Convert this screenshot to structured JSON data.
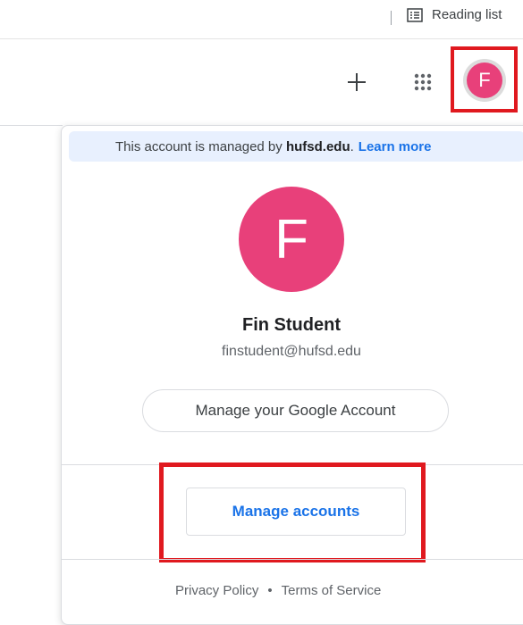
{
  "bookmarks_bar": {
    "reading_list_label": "Reading list",
    "icons": {
      "reading_list": "reading-list-icon"
    }
  },
  "header": {
    "icons": {
      "add": "plus-icon",
      "apps": "apps-grid-icon"
    },
    "avatar_letter": "F"
  },
  "account_popup": {
    "managed_banner": {
      "prefix": "This account is managed by",
      "domain": "hufsd.edu",
      "suffix": ".",
      "learn_more": "Learn more"
    },
    "avatar_letter": "F",
    "name": "Fin Student",
    "email": "finstudent@hufsd.edu",
    "manage_google_account": "Manage your Google Account",
    "manage_accounts": "Manage accounts",
    "footer": {
      "privacy": "Privacy Policy",
      "separator": "•",
      "terms": "Terms of Service"
    }
  },
  "colors": {
    "avatar": "#e8407a",
    "highlight": "#e0191f",
    "link": "#1a73e8",
    "banner_bg": "#e8f0fe"
  }
}
